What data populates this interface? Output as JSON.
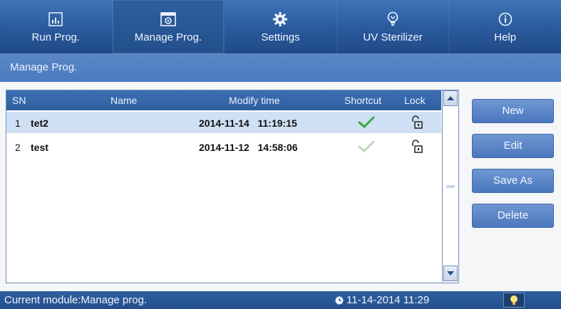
{
  "nav": {
    "tabs": [
      {
        "label": "Run Prog.",
        "icon": "chart-icon"
      },
      {
        "label": "Manage Prog.",
        "icon": "settings-box-icon",
        "active": true
      },
      {
        "label": "Settings",
        "icon": "gear-icon"
      },
      {
        "label": "UV Sterilizer",
        "icon": "uv-icon"
      },
      {
        "label": "Help",
        "icon": "info-icon"
      }
    ]
  },
  "page": {
    "subtitle": "Manage Prog."
  },
  "table": {
    "headers": {
      "sn": "SN",
      "name": "Name",
      "modify_time": "Modify time",
      "shortcut": "Shortcut",
      "lock": "Lock"
    },
    "rows": [
      {
        "sn": "1",
        "name": "tet2",
        "modify_time": "2014-11-14   11:19:15",
        "shortcut": true,
        "lock": "unlocked",
        "selected": true
      },
      {
        "sn": "2",
        "name": "test",
        "modify_time": "2014-11-12   14:58:06",
        "shortcut": false,
        "lock": "unlocked",
        "selected": false
      }
    ]
  },
  "actions": {
    "new": "New",
    "edit": "Edit",
    "save_as": "Save As",
    "delete": "Delete"
  },
  "status": {
    "module": "Current module:Manage prog.",
    "datetime": "11-14-2014 11:29"
  },
  "colors": {
    "accent": "#2f5f9f",
    "check_active": "#3aa83a",
    "check_inactive": "#b8d8b8",
    "selected_row": "#cfe0f4"
  }
}
